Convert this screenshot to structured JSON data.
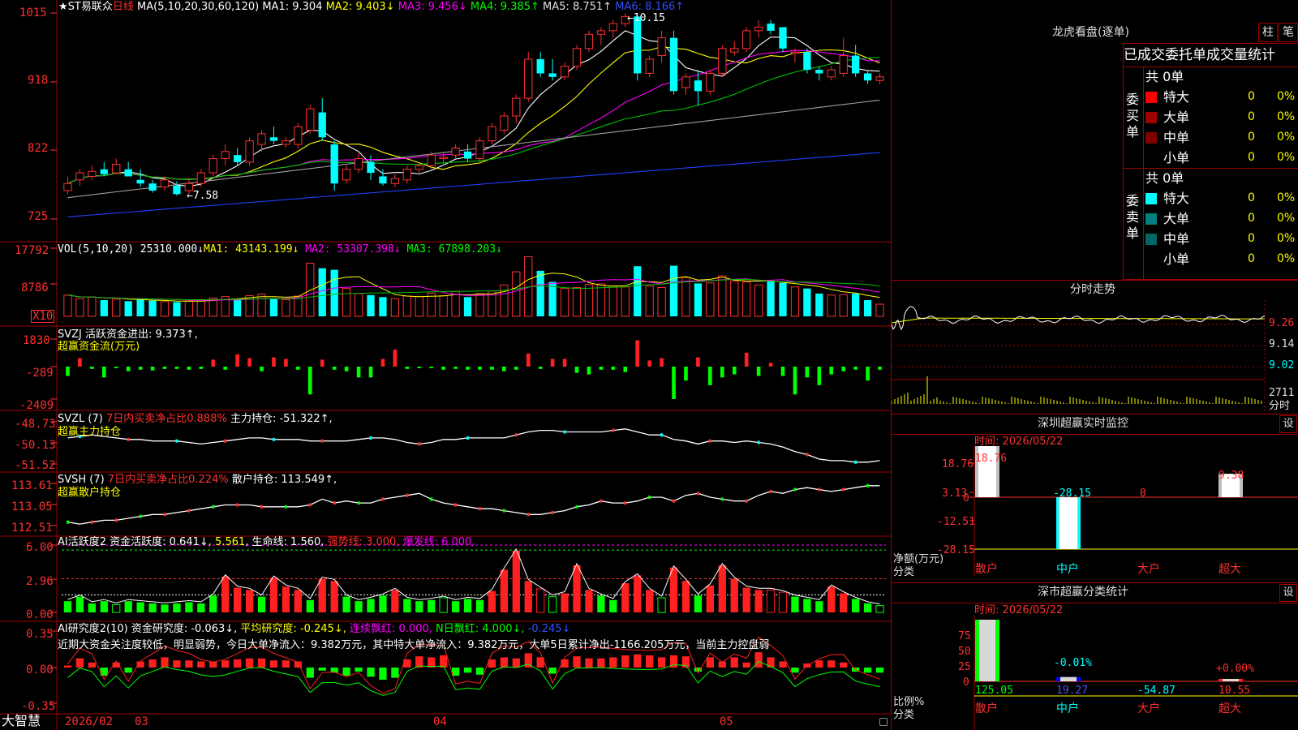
{
  "app": {
    "brand": "大智慧"
  },
  "main_chart": {
    "title_star": "★",
    "stock_name": "ST易联众",
    "period": "日线",
    "ma_params": "MA(5,10,20,30,60,120)",
    "ma1": "MA1: 9.304",
    "ma2": "MA2: 9.403↓",
    "ma3": "MA3: 9.456↓",
    "ma4": "MA4: 9.385↑",
    "ma5": "MA5: 8.751↑",
    "ma6": "MA6: 8.166↑",
    "y_labels": [
      "1015",
      "918",
      "822",
      "725"
    ],
    "high_label": "←10.15",
    "low_label": "←7.58"
  },
  "vol_panel": {
    "title": "VOL(5,10,20)",
    "value": "25310.000↓",
    "ma1": "MA1: 43143.199↓",
    "ma2": "MA2: 53307.398↓",
    "ma3": "MA3: 67898.203↓",
    "y_labels": [
      "17792",
      "8786"
    ],
    "unit": "X10"
  },
  "svzj_panel": {
    "title": "SVZJ",
    "label": "活跃资金进出: 9.373↑,",
    "subtitle": "超赢资金流(万元)",
    "y_labels": [
      "1830",
      "-289",
      "-2409"
    ]
  },
  "svzl_panel": {
    "title": "SVZL (7)",
    "ratio": "7日内买卖净占比0.888%",
    "hold": "主力持仓: -51.322↑,",
    "subtitle": "超赢主力持仓",
    "y_labels": [
      "-48.73",
      "-50.13",
      "-51.52"
    ]
  },
  "svsh_panel": {
    "title": "SVSH (7)",
    "ratio": "7日内买卖净占比0.224%",
    "hold": "散户持仓: 113.549↑,",
    "subtitle": "超赢散户持仓",
    "y_labels": [
      "113.61",
      "113.05",
      "112.51"
    ]
  },
  "ai_active_panel": {
    "title": "AI活跃度2",
    "activity": "资金活跃度: 0.641↓",
    "val2": "5.561",
    "life": "生命线: 1.560,",
    "strong": "强势线: 3.000,",
    "burst": "爆发线: 6.000,",
    "y_labels": [
      "6.00",
      "2.96",
      "0.00"
    ]
  },
  "ai_research_panel": {
    "title": "AI研究度2(10)",
    "research": "资金研究度: -0.063↓,",
    "avg": "平均研究度: -0.245↓,",
    "streak": "连续飘红: 0.000,",
    "n_days": "N日飘红: 4.000↓,",
    "extra": "-0.245↓",
    "comment": "近期大资金关注度较低，明显弱势，今日大单净流入：9.382万元，其中特大单净流入：9.382万元，大单5日累计净出-1166.205万元，当前主力控盘弱",
    "y_labels": [
      "0.35",
      "0.00",
      "-0.35"
    ]
  },
  "x_axis": {
    "labels": [
      "2026/02",
      "03",
      "04",
      "05"
    ]
  },
  "dragon_tiger": {
    "title": "龙虎看盘(逐单)",
    "btn_bar": "柱",
    "btn_pen": "笔",
    "tabs": [
      "已成交",
      "委托单",
      "成交量统计"
    ],
    "buy": {
      "side": "委买单",
      "total": "共 0单",
      "rows": [
        {
          "label": "特大",
          "count": "0",
          "pct": "0%",
          "color": "#ff0000"
        },
        {
          "label": "大单",
          "count": "0",
          "pct": "0%",
          "color": "#a00000"
        },
        {
          "label": "中单",
          "count": "0",
          "pct": "0%",
          "color": "#800000"
        },
        {
          "label": "小单",
          "count": "0",
          "pct": "0%",
          "color": "#000000"
        }
      ]
    },
    "sell": {
      "side": "委卖单",
      "total": "共 0单",
      "rows": [
        {
          "label": "特大",
          "count": "0",
          "pct": "0%",
          "color": "#00ffff"
        },
        {
          "label": "大单",
          "count": "0",
          "pct": "0%",
          "color": "#008080"
        },
        {
          "label": "中单",
          "count": "0",
          "pct": "0%",
          "color": "#006666"
        },
        {
          "label": "小单",
          "count": "0",
          "pct": "0%",
          "color": "#000000"
        }
      ]
    }
  },
  "intraday": {
    "title": "分时走势",
    "y_labels": [
      "9.26",
      "9.14",
      "9.02"
    ],
    "vol_label": "2711",
    "unit": "分时"
  },
  "sz_monitor": {
    "title": "深圳超赢实时监控",
    "btn": "设",
    "time": "时间: 2026/05/22",
    "y_labels": [
      "18.76",
      "3.13",
      "0",
      "-12.51",
      "-28.15"
    ],
    "ylabel": "净额(万元)",
    "xlabel": "分类",
    "categories": [
      "散户",
      "中户",
      "大户",
      "超大"
    ],
    "bar_labels": [
      "18.76",
      "-28.15",
      "0",
      "9.38"
    ]
  },
  "sz_classify": {
    "title": "深市超赢分类统计",
    "btn": "设",
    "time": "时间: 2026/05/22",
    "y_labels": [
      "75",
      "50",
      "25",
      "0"
    ],
    "ylabel": "比例%",
    "xlabel": "分类",
    "categories": [
      "散户",
      "中户",
      "大户",
      "超大"
    ],
    "bottom_values": [
      "125.05",
      "19.27",
      "-54.87",
      "10.55"
    ],
    "bar_labels": [
      "-0.01%",
      "+0.00%"
    ]
  },
  "chart_data": [
    {
      "type": "candlestick",
      "title": "ST易联众 日线",
      "x_ticks": [
        "2026/02",
        "03",
        "04",
        "05"
      ],
      "y_ticks": [
        7.25,
        8.22,
        9.18,
        10.15
      ],
      "ohlc": [
        [
          7.65,
          7.85,
          7.6,
          7.75
        ],
        [
          7.8,
          7.95,
          7.72,
          7.9
        ],
        [
          7.85,
          8.0,
          7.8,
          7.92
        ],
        [
          7.95,
          8.05,
          7.85,
          7.88
        ],
        [
          7.9,
          8.1,
          7.88,
          8.02
        ],
        [
          7.95,
          8.05,
          7.88,
          7.85
        ],
        [
          7.8,
          7.95,
          7.7,
          7.75
        ],
        [
          7.75,
          7.8,
          7.62,
          7.65
        ],
        [
          7.7,
          7.85,
          7.65,
          7.8
        ],
        [
          7.72,
          7.78,
          7.58,
          7.6
        ],
        [
          7.65,
          7.8,
          7.6,
          7.75
        ],
        [
          7.75,
          7.95,
          7.7,
          7.9
        ],
        [
          7.9,
          8.15,
          7.85,
          8.1
        ],
        [
          8.1,
          8.3,
          8.0,
          8.2
        ],
        [
          8.15,
          8.25,
          8.0,
          8.05
        ],
        [
          8.05,
          8.4,
          8.0,
          8.35
        ],
        [
          8.3,
          8.5,
          8.2,
          8.45
        ],
        [
          8.4,
          8.55,
          8.3,
          8.35
        ],
        [
          8.3,
          8.4,
          8.25,
          8.35
        ],
        [
          8.3,
          8.6,
          8.25,
          8.55
        ],
        [
          8.5,
          8.85,
          8.45,
          8.8
        ],
        [
          8.75,
          8.95,
          8.35,
          8.4
        ],
        [
          8.3,
          8.35,
          7.65,
          7.75
        ],
        [
          7.8,
          8.0,
          7.75,
          7.95
        ],
        [
          7.95,
          8.2,
          7.9,
          8.1
        ],
        [
          8.05,
          8.15,
          7.8,
          7.9
        ],
        [
          7.85,
          7.95,
          7.72,
          7.75
        ],
        [
          7.75,
          7.88,
          7.7,
          7.82
        ],
        [
          7.8,
          8.0,
          7.75,
          7.95
        ],
        [
          7.95,
          8.05,
          7.9,
          8.0
        ],
        [
          8.0,
          8.2,
          7.95,
          8.15
        ],
        [
          8.1,
          8.2,
          8.0,
          8.12
        ],
        [
          8.15,
          8.3,
          8.1,
          8.25
        ],
        [
          8.2,
          8.3,
          8.05,
          8.1
        ],
        [
          8.1,
          8.4,
          8.05,
          8.35
        ],
        [
          8.35,
          8.6,
          8.3,
          8.55
        ],
        [
          8.5,
          8.75,
          8.45,
          8.7
        ],
        [
          8.7,
          9.0,
          8.6,
          8.95
        ],
        [
          8.95,
          9.6,
          8.9,
          9.5
        ],
        [
          9.5,
          9.6,
          9.25,
          9.3
        ],
        [
          9.3,
          9.5,
          9.2,
          9.25
        ],
        [
          9.25,
          9.45,
          9.2,
          9.4
        ],
        [
          9.4,
          9.7,
          9.35,
          9.65
        ],
        [
          9.65,
          9.9,
          9.6,
          9.85
        ],
        [
          9.85,
          9.95,
          9.7,
          9.9
        ],
        [
          9.9,
          10.05,
          9.8,
          10.0
        ],
        [
          10.0,
          10.15,
          9.95,
          10.1
        ],
        [
          10.1,
          10.15,
          9.2,
          9.3
        ],
        [
          9.3,
          9.55,
          9.25,
          9.5
        ],
        [
          9.55,
          9.9,
          9.45,
          9.8
        ],
        [
          9.8,
          9.9,
          9.0,
          9.05
        ],
        [
          9.1,
          9.3,
          9.0,
          9.25
        ],
        [
          9.2,
          9.35,
          8.85,
          9.05
        ],
        [
          9.05,
          9.35,
          9.0,
          9.3
        ],
        [
          9.3,
          9.7,
          9.25,
          9.65
        ],
        [
          9.6,
          9.75,
          9.55,
          9.65
        ],
        [
          9.65,
          9.95,
          9.6,
          9.9
        ],
        [
          9.9,
          10.05,
          9.8,
          9.95
        ],
        [
          10.0,
          10.05,
          9.85,
          9.9
        ],
        [
          9.95,
          9.95,
          9.6,
          9.65
        ],
        [
          9.6,
          9.65,
          9.45,
          9.6
        ],
        [
          9.6,
          9.65,
          9.3,
          9.35
        ],
        [
          9.35,
          9.4,
          9.2,
          9.3
        ],
        [
          9.25,
          9.4,
          9.2,
          9.35
        ],
        [
          9.3,
          9.8,
          9.25,
          9.55
        ],
        [
          9.55,
          9.7,
          9.25,
          9.3
        ],
        [
          9.3,
          9.35,
          9.15,
          9.2
        ],
        [
          9.2,
          9.3,
          9.15,
          9.25
        ]
      ],
      "ma_lines": [
        {
          "name": "MA1",
          "color": "#ffffff"
        },
        {
          "name": "MA2",
          "color": "#ffff00"
        },
        {
          "name": "MA3",
          "color": "#ff00ff"
        },
        {
          "name": "MA4",
          "color": "#00c000"
        },
        {
          "name": "MA5",
          "color": "#a0a0a0"
        },
        {
          "name": "MA6",
          "color": "#2040ff"
        }
      ]
    },
    {
      "type": "bar",
      "title": "VOL(5,10,20)",
      "y_ticks": [
        8786,
        17792
      ],
      "values": [
        4.2,
        3.5,
        3.8,
        3.2,
        3.4,
        3.0,
        3.3,
        3.1,
        2.9,
        2.8,
        3.0,
        3.3,
        3.6,
        3.9,
        3.5,
        4.1,
        4.4,
        3.6,
        3.3,
        4.0,
        10.5,
        9.5,
        9.2,
        5.5,
        4.5,
        4.2,
        3.8,
        3.5,
        4.0,
        3.9,
        4.6,
        4.1,
        4.9,
        3.8,
        4.5,
        5.0,
        6.2,
        8.8,
        11.8,
        9.0,
        6.8,
        5.5,
        5.7,
        6.3,
        6.4,
        6.0,
        5.8,
        9.9,
        6.0,
        5.7,
        10.0,
        7.7,
        6.5,
        6.6,
        8.0,
        7.0,
        6.8,
        6.2,
        7.0,
        6.6,
        5.8,
        5.5,
        4.5,
        4.2,
        4.3,
        4.5,
        3.2,
        2.4
      ]
    },
    {
      "type": "bar",
      "title": "超赢资金流(万元)",
      "y_ticks": [
        -2409,
        -289,
        1830
      ],
      "values": [
        -600,
        550,
        -150,
        -700,
        -100,
        -300,
        -200,
        -250,
        -150,
        -150,
        -200,
        -150,
        450,
        -200,
        800,
        550,
        -300,
        600,
        500,
        -200,
        -1800,
        450,
        -200,
        -300,
        -700,
        -700,
        500,
        1100,
        -150,
        -100,
        -100,
        -200,
        -150,
        -200,
        -200,
        -200,
        -300,
        -200,
        850,
        -150,
        500,
        500,
        -400,
        -500,
        -200,
        -200,
        -350,
        1700,
        400,
        550,
        -2100,
        -900,
        600,
        -1200,
        -700,
        -500,
        900,
        -600,
        250,
        -600,
        -1800,
        -700,
        -1200,
        -500,
        -300,
        -200,
        -900,
        -200
      ]
    },
    {
      "type": "line",
      "title": "超赢主力持仓",
      "y_ticks": [
        -51.52,
        -50.13,
        -48.73
      ],
      "series": [
        {
          "name": "主力持仓",
          "values": [
            -49.8,
            -49.7,
            -49.6,
            -49.7,
            -49.8,
            -49.9,
            -49.9,
            -50.0,
            -50.0,
            -50.0,
            -50.1,
            -50.2,
            -50.1,
            -50.0,
            -49.9,
            -49.8,
            -49.8,
            -49.9,
            -49.9,
            -49.9,
            -50.0,
            -50.0,
            -50.0,
            -50.0,
            -49.9,
            -49.8,
            -49.8,
            -49.9,
            -50.1,
            -50.2,
            -50.1,
            -49.9,
            -49.9,
            -49.8,
            -49.8,
            -49.8,
            -49.8,
            -49.6,
            -49.4,
            -49.3,
            -49.3,
            -49.4,
            -49.4,
            -49.4,
            -49.4,
            -49.3,
            -49.2,
            -49.4,
            -49.6,
            -49.6,
            -49.9,
            -50.0,
            -50.2,
            -50.0,
            -50.0,
            -50.1,
            -50.0,
            -50.1,
            -50.2,
            -50.4,
            -50.7,
            -50.9,
            -51.2,
            -51.3,
            -51.3,
            -51.4,
            -51.4,
            -51.3
          ]
        }
      ]
    },
    {
      "type": "line",
      "title": "超赢散户持仓",
      "y_ticks": [
        112.51,
        113.05,
        113.61
      ],
      "series": [
        {
          "name": "散户持仓",
          "values": [
            112.6,
            112.55,
            112.6,
            112.65,
            112.65,
            112.7,
            112.75,
            112.8,
            112.8,
            112.85,
            112.9,
            112.95,
            113.0,
            113.05,
            113.05,
            113.05,
            113.0,
            113.0,
            113.0,
            113.0,
            113.05,
            113.2,
            113.1,
            113.15,
            113.1,
            113.1,
            113.2,
            113.25,
            113.3,
            113.35,
            113.2,
            113.1,
            113.05,
            113.0,
            112.95,
            112.95,
            112.9,
            112.85,
            112.8,
            112.8,
            112.85,
            112.9,
            113.0,
            113.05,
            113.15,
            113.1,
            113.1,
            113.15,
            113.25,
            113.25,
            113.15,
            113.3,
            113.35,
            113.25,
            113.2,
            113.15,
            113.15,
            113.3,
            113.4,
            113.35,
            113.45,
            113.5,
            113.45,
            113.4,
            113.45,
            113.5,
            113.55,
            113.55
          ]
        }
      ]
    },
    {
      "type": "bar",
      "title": "AI活跃度2",
      "y_ticks": [
        0.0,
        2.96,
        6.0
      ],
      "series": [
        {
          "name": "资金活跃度",
          "values": [
            1.0,
            1.4,
            0.8,
            1.0,
            0.7,
            1.0,
            0.9,
            0.8,
            0.7,
            0.8,
            0.9,
            0.8,
            1.5,
            3.2,
            2.2,
            2.0,
            1.4,
            3.1,
            2.3,
            2.0,
            1.1,
            3.0,
            2.8,
            1.4,
            1.0,
            1.2,
            1.5,
            2.0,
            1.2,
            1.0,
            1.1,
            1.3,
            1.0,
            1.2,
            1.1,
            1.9,
            3.8,
            5.5,
            2.8,
            2.1,
            1.4,
            1.7,
            4.2,
            2.0,
            1.5,
            1.1,
            2.6,
            3.3,
            2.0,
            1.3,
            4.0,
            2.8,
            1.5,
            2.4,
            4.2,
            3.0,
            2.2,
            2.0,
            2.0,
            1.8,
            1.4,
            1.2,
            1.0,
            2.3,
            1.7,
            1.2,
            0.8,
            0.6
          ]
        }
      ]
    },
    {
      "type": "bar",
      "title": "AI研究度2(10)",
      "y_ticks": [
        -0.35,
        0.0,
        0.35
      ],
      "series": [
        {
          "name": "资金研究度",
          "values": [
            0.02,
            0.09,
            0.05,
            -0.08,
            0.05,
            -0.05,
            0.06,
            0.08,
            0.1,
            0.07,
            0.07,
            0.06,
            0.06,
            0.07,
            0.08,
            0.09,
            0.09,
            0.07,
            0.07,
            0.06,
            -0.1,
            -0.03,
            -0.05,
            -0.08,
            -0.04,
            -0.09,
            -0.12,
            -0.1,
            0.08,
            0.11,
            0.1,
            0.12,
            -0.08,
            -0.05,
            -0.07,
            0.08,
            0.1,
            0.09,
            0.14,
            0.1,
            -0.06,
            0.08,
            0.11,
            0.09,
            0.09,
            0.1,
            0.12,
            0.13,
            0.12,
            0.1,
            0.12,
            0.11,
            -0.04,
            0.1,
            0.06,
            0.1,
            0.05,
            0.15,
            0.1,
            0.06,
            -0.05,
            0.04,
            0.07,
            0.07,
            0.05,
            -0.04,
            -0.05,
            -0.05
          ]
        }
      ]
    }
  ]
}
